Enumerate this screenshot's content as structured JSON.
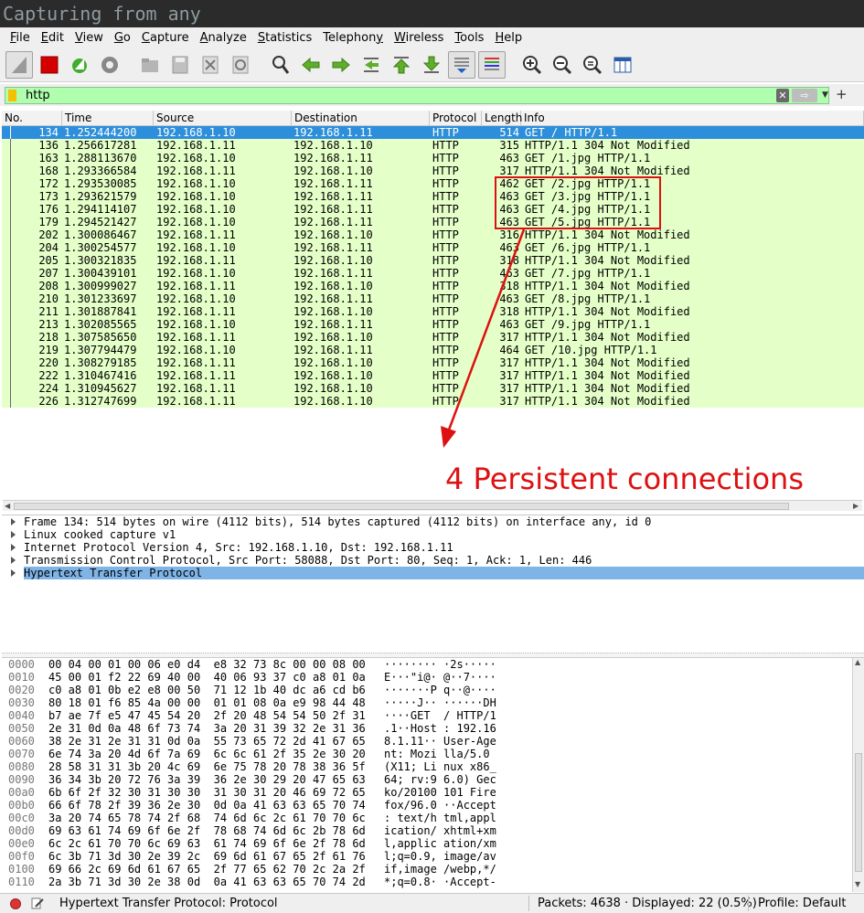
{
  "window": {
    "title": "Capturing from any"
  },
  "menu": [
    {
      "acc": "F",
      "rest": "ile"
    },
    {
      "acc": "E",
      "rest": "dit"
    },
    {
      "acc": "V",
      "rest": "iew"
    },
    {
      "acc": "G",
      "rest": "o"
    },
    {
      "acc": "C",
      "rest": "apture"
    },
    {
      "acc": "A",
      "rest": "nalyze"
    },
    {
      "acc": "S",
      "rest": "tatistics"
    },
    {
      "acc": "",
      "rest": "Telephon",
      "acc2": "y"
    },
    {
      "acc": "W",
      "rest": "ireless"
    },
    {
      "acc": "T",
      "rest": "ools"
    },
    {
      "acc": "H",
      "rest": "elp"
    }
  ],
  "toolbar_icons": [
    "shark-fin-icon",
    "stop-capture-icon",
    "restart-capture-icon",
    "capture-options-icon",
    "open-file-icon",
    "save-file-icon",
    "close-file-icon",
    "reload-file-icon",
    "find-packet-icon",
    "go-back-icon",
    "go-forward-icon",
    "go-to-packet-icon",
    "go-first-icon",
    "go-last-icon",
    "auto-scroll-icon",
    "colorize-icon",
    "zoom-in-icon",
    "zoom-out-icon",
    "zoom-normal-icon",
    "resize-columns-icon"
  ],
  "filter": {
    "value": "http"
  },
  "columns": [
    "No.",
    "Time",
    "Source",
    "Destination",
    "Protocol",
    "Length",
    "Info"
  ],
  "packets": [
    {
      "no": "134",
      "time": "1.252444200",
      "src": "192.168.1.10",
      "dst": "192.168.1.11",
      "proto": "HTTP",
      "len": "514",
      "info": "GET / HTTP/1.1",
      "selected": true
    },
    {
      "no": "136",
      "time": "1.256617281",
      "src": "192.168.1.11",
      "dst": "192.168.1.10",
      "proto": "HTTP",
      "len": "315",
      "info": "HTTP/1.1 304 Not Modified"
    },
    {
      "no": "163",
      "time": "1.288113670",
      "src": "192.168.1.10",
      "dst": "192.168.1.11",
      "proto": "HTTP",
      "len": "463",
      "info": "GET /1.jpg HTTP/1.1"
    },
    {
      "no": "168",
      "time": "1.293366584",
      "src": "192.168.1.11",
      "dst": "192.168.1.10",
      "proto": "HTTP",
      "len": "317",
      "info": "HTTP/1.1 304 Not Modified"
    },
    {
      "no": "172",
      "time": "1.293530085",
      "src": "192.168.1.10",
      "dst": "192.168.1.11",
      "proto": "HTTP",
      "len": "462",
      "info": "GET /2.jpg HTTP/1.1"
    },
    {
      "no": "173",
      "time": "1.293621579",
      "src": "192.168.1.10",
      "dst": "192.168.1.11",
      "proto": "HTTP",
      "len": "463",
      "info": "GET /3.jpg HTTP/1.1"
    },
    {
      "no": "176",
      "time": "1.294114107",
      "src": "192.168.1.10",
      "dst": "192.168.1.11",
      "proto": "HTTP",
      "len": "463",
      "info": "GET /4.jpg HTTP/1.1"
    },
    {
      "no": "179",
      "time": "1.294521427",
      "src": "192.168.1.10",
      "dst": "192.168.1.11",
      "proto": "HTTP",
      "len": "463",
      "info": "GET /5.jpg HTTP/1.1"
    },
    {
      "no": "202",
      "time": "1.300086467",
      "src": "192.168.1.11",
      "dst": "192.168.1.10",
      "proto": "HTTP",
      "len": "316",
      "info": "HTTP/1.1 304 Not Modified"
    },
    {
      "no": "204",
      "time": "1.300254577",
      "src": "192.168.1.10",
      "dst": "192.168.1.11",
      "proto": "HTTP",
      "len": "463",
      "info": "GET /6.jpg HTTP/1.1"
    },
    {
      "no": "205",
      "time": "1.300321835",
      "src": "192.168.1.11",
      "dst": "192.168.1.10",
      "proto": "HTTP",
      "len": "318",
      "info": "HTTP/1.1 304 Not Modified"
    },
    {
      "no": "207",
      "time": "1.300439101",
      "src": "192.168.1.10",
      "dst": "192.168.1.11",
      "proto": "HTTP",
      "len": "463",
      "info": "GET /7.jpg HTTP/1.1"
    },
    {
      "no": "208",
      "time": "1.300999027",
      "src": "192.168.1.11",
      "dst": "192.168.1.10",
      "proto": "HTTP",
      "len": "318",
      "info": "HTTP/1.1 304 Not Modified"
    },
    {
      "no": "210",
      "time": "1.301233697",
      "src": "192.168.1.10",
      "dst": "192.168.1.11",
      "proto": "HTTP",
      "len": "463",
      "info": "GET /8.jpg HTTP/1.1"
    },
    {
      "no": "211",
      "time": "1.301887841",
      "src": "192.168.1.11",
      "dst": "192.168.1.10",
      "proto": "HTTP",
      "len": "318",
      "info": "HTTP/1.1 304 Not Modified"
    },
    {
      "no": "213",
      "time": "1.302085565",
      "src": "192.168.1.10",
      "dst": "192.168.1.11",
      "proto": "HTTP",
      "len": "463",
      "info": "GET /9.jpg HTTP/1.1"
    },
    {
      "no": "218",
      "time": "1.307585650",
      "src": "192.168.1.11",
      "dst": "192.168.1.10",
      "proto": "HTTP",
      "len": "317",
      "info": "HTTP/1.1 304 Not Modified"
    },
    {
      "no": "219",
      "time": "1.307794479",
      "src": "192.168.1.10",
      "dst": "192.168.1.11",
      "proto": "HTTP",
      "len": "464",
      "info": "GET /10.jpg HTTP/1.1"
    },
    {
      "no": "220",
      "time": "1.308279185",
      "src": "192.168.1.11",
      "dst": "192.168.1.10",
      "proto": "HTTP",
      "len": "317",
      "info": "HTTP/1.1 304 Not Modified"
    },
    {
      "no": "222",
      "time": "1.310467416",
      "src": "192.168.1.11",
      "dst": "192.168.1.10",
      "proto": "HTTP",
      "len": "317",
      "info": "HTTP/1.1 304 Not Modified"
    },
    {
      "no": "224",
      "time": "1.310945627",
      "src": "192.168.1.11",
      "dst": "192.168.1.10",
      "proto": "HTTP",
      "len": "317",
      "info": "HTTP/1.1 304 Not Modified"
    },
    {
      "no": "226",
      "time": "1.312747699",
      "src": "192.168.1.11",
      "dst": "192.168.1.10",
      "proto": "HTTP",
      "len": "317",
      "info": "HTTP/1.1 304 Not Modified"
    }
  ],
  "annotation": {
    "label": "4 Persistent connections",
    "color": "#dd1111"
  },
  "details": [
    "Frame 134: 514 bytes on wire (4112 bits), 514 bytes captured (4112 bits) on interface any, id 0",
    "Linux cooked capture v1",
    "Internet Protocol Version 4, Src: 192.168.1.10, Dst: 192.168.1.11",
    "Transmission Control Protocol, Src Port: 58088, Dst Port: 80, Seq: 1, Ack: 1, Len: 446",
    "Hypertext Transfer Protocol"
  ],
  "bytes": [
    {
      "off": "0000",
      "hex": "00 04 00 01 00 06 e0 d4  e8 32 73 8c 00 00 08 00",
      "ascii": "········ ·2s·····"
    },
    {
      "off": "0010",
      "hex": "45 00 01 f2 22 69 40 00  40 06 93 37 c0 a8 01 0a",
      "ascii": "E···\"i@· @··7····"
    },
    {
      "off": "0020",
      "hex": "c0 a8 01 0b e2 e8 00 50  71 12 1b 40 dc a6 cd b6",
      "ascii": "·······P q··@····"
    },
    {
      "off": "0030",
      "hex": "80 18 01 f6 85 4a 00 00  01 01 08 0a e9 98 44 48",
      "ascii": "·····J·· ······DH"
    },
    {
      "off": "0040",
      "hex": "b7 ae 7f e5 47 45 54 20  2f 20 48 54 54 50 2f 31",
      "ascii": "····GET  / HTTP/1"
    },
    {
      "off": "0050",
      "hex": "2e 31 0d 0a 48 6f 73 74  3a 20 31 39 32 2e 31 36",
      "ascii": ".1··Host : 192.16"
    },
    {
      "off": "0060",
      "hex": "38 2e 31 2e 31 31 0d 0a  55 73 65 72 2d 41 67 65",
      "ascii": "8.1.11·· User-Age"
    },
    {
      "off": "0070",
      "hex": "6e 74 3a 20 4d 6f 7a 69  6c 6c 61 2f 35 2e 30 20",
      "ascii": "nt: Mozi lla/5.0 "
    },
    {
      "off": "0080",
      "hex": "28 58 31 31 3b 20 4c 69  6e 75 78 20 78 38 36 5f",
      "ascii": "(X11; Li nux x86_"
    },
    {
      "off": "0090",
      "hex": "36 34 3b 20 72 76 3a 39  36 2e 30 29 20 47 65 63",
      "ascii": "64; rv:9 6.0) Gec"
    },
    {
      "off": "00a0",
      "hex": "6b 6f 2f 32 30 31 30 30  31 30 31 20 46 69 72 65",
      "ascii": "ko/20100 101 Fire"
    },
    {
      "off": "00b0",
      "hex": "66 6f 78 2f 39 36 2e 30  0d 0a 41 63 63 65 70 74",
      "ascii": "fox/96.0 ··Accept"
    },
    {
      "off": "00c0",
      "hex": "3a 20 74 65 78 74 2f 68  74 6d 6c 2c 61 70 70 6c",
      "ascii": ": text/h tml,appl"
    },
    {
      "off": "00d0",
      "hex": "69 63 61 74 69 6f 6e 2f  78 68 74 6d 6c 2b 78 6d",
      "ascii": "ication/ xhtml+xm"
    },
    {
      "off": "00e0",
      "hex": "6c 2c 61 70 70 6c 69 63  61 74 69 6f 6e 2f 78 6d",
      "ascii": "l,applic ation/xm"
    },
    {
      "off": "00f0",
      "hex": "6c 3b 71 3d 30 2e 39 2c  69 6d 61 67 65 2f 61 76",
      "ascii": "l;q=0.9, image/av"
    },
    {
      "off": "0100",
      "hex": "69 66 2c 69 6d 61 67 65  2f 77 65 62 70 2c 2a 2f",
      "ascii": "if,image /webp,*/"
    },
    {
      "off": "0110",
      "hex": "2a 3b 71 3d 30 2e 38 0d  0a 41 63 63 65 70 74 2d",
      "ascii": "*;q=0.8· ·Accept-"
    }
  ],
  "status": {
    "field": "Hypertext Transfer Protocol: Protocol",
    "packets": "Packets: 4638 · Displayed: 22 (0.5%)",
    "profile": "Profile: Default"
  }
}
